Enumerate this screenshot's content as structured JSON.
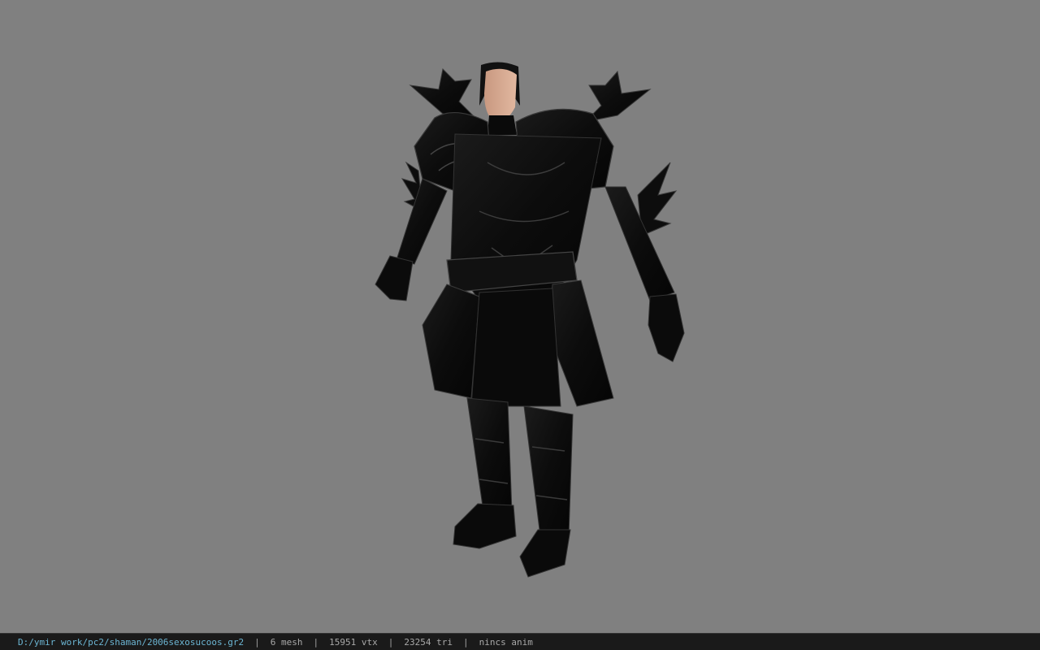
{
  "viewport": {
    "background_color": "#808080",
    "model": "dark armored character",
    "armor_color": "#0c0c0c",
    "trim_color": "#3a3a3a",
    "skin_color": "#d0a48a"
  },
  "status_bar": {
    "file_path": "D:/ymir work/pc2/shaman/2006sexosucoos.gr2",
    "separator": "|",
    "mesh": "6 mesh",
    "vtx": "15951 vtx",
    "tri": "23254 tri",
    "anim": "nincs anim",
    "path_color": "#6cb6d4"
  }
}
